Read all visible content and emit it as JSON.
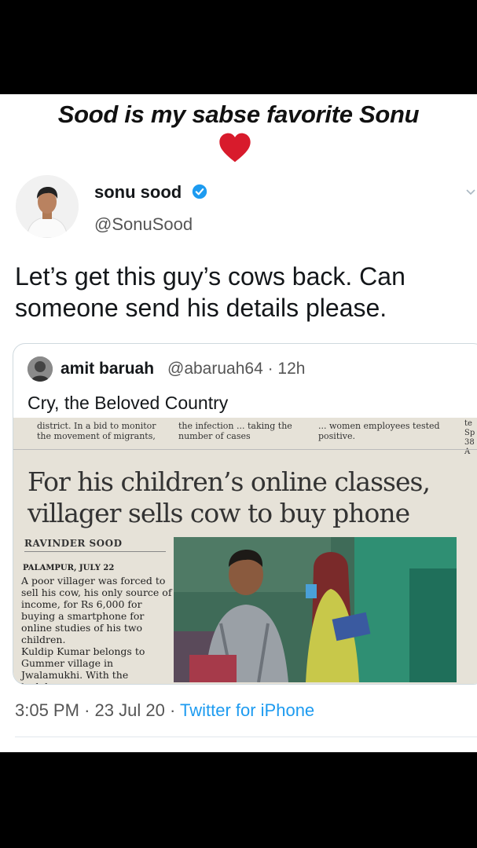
{
  "caption": "Sood is my sabse favorite Sonu",
  "colors": {
    "heart": "#d81b2c",
    "verified": "#1d9bf0",
    "link": "#1d9bf0"
  },
  "icons": [
    "heart-icon",
    "verified-badge-icon",
    "chevron-down-icon"
  ],
  "tweet": {
    "author_name": "sonu sood",
    "author_handle": "@SonuSood",
    "text": "Let’s get this guy’s cows back. Can someone send his details please.",
    "time": "3:05 PM",
    "date": "23 Jul 20",
    "separator": "·",
    "source": "Twitter for iPhone"
  },
  "quoted": {
    "author_name": "amit baruah",
    "author_handle": "@abaruah64 · 12h",
    "text": "Cry, the Beloved Country"
  },
  "newspaper": {
    "top_left": "district. In a bid to monitor the movement of migrants,",
    "top_mid": "the infection ... taking the number of cases",
    "top_right": "... women employees tested positive.",
    "edge_text": "te\nSp\n38\nA",
    "headline": "For his children’s online classes, villager sells cow to buy phone",
    "byline": "RAVINDER SOOD",
    "dateline": "PALAMPUR, JULY 22",
    "body": "A poor villager was forced to sell his cow, his only source of income, for Rs 6,000 for buying a smartphone for online studies of his two children.\n Kuldip Kumar belongs to Gummer village in Jwalamukhi. With the lockdown"
  }
}
